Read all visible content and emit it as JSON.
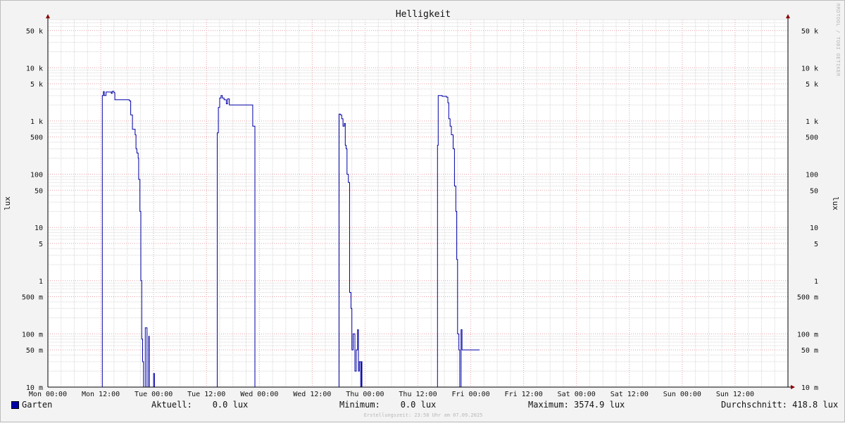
{
  "chart_data": {
    "type": "line",
    "title": "Helligkeit",
    "ylabel": "lux",
    "ylabel_right": "lux",
    "yscale": "log",
    "ylim": [
      0.01,
      80000
    ],
    "xlim": [
      "Mon 00:00",
      "Sun 24:00"
    ],
    "grid": true,
    "x_tick_labels": [
      "Mon 00:00",
      "Mon 12:00",
      "Tue 00:00",
      "Tue 12:00",
      "Wed 00:00",
      "Wed 12:00",
      "Thu 00:00",
      "Thu 12:00",
      "Fri 00:00",
      "Fri 12:00",
      "Sat 00:00",
      "Sat 12:00",
      "Sun 00:00",
      "Sun 12:00"
    ],
    "y_ticks": [
      {
        "value": 50000,
        "label": "50 k"
      },
      {
        "value": 10000,
        "label": "10 k"
      },
      {
        "value": 5000,
        "label": "5 k"
      },
      {
        "value": 1000,
        "label": "1 k"
      },
      {
        "value": 500,
        "label": "500"
      },
      {
        "value": 100,
        "label": "100"
      },
      {
        "value": 50,
        "label": "50"
      },
      {
        "value": 10,
        "label": "10"
      },
      {
        "value": 5,
        "label": "5"
      },
      {
        "value": 1,
        "label": "1"
      },
      {
        "value": 0.5,
        "label": "500 m"
      },
      {
        "value": 0.1,
        "label": "100 m"
      },
      {
        "value": 0.05,
        "label": "50 m"
      },
      {
        "value": 0.01,
        "label": "10 m"
      }
    ],
    "series": [
      {
        "name": "Garten",
        "color": "#0000a8",
        "x_unit": "hours since Mon 00:00",
        "points": [
          [
            0,
            0.01
          ],
          [
            12.3,
            0.01
          ],
          [
            12.35,
            3000
          ],
          [
            12.6,
            3574.9
          ],
          [
            12.8,
            3000
          ],
          [
            13.2,
            3500
          ],
          [
            14.0,
            3500
          ],
          [
            14.4,
            3300
          ],
          [
            14.6,
            3600
          ],
          [
            15.0,
            3400
          ],
          [
            15.2,
            2500
          ],
          [
            16.5,
            2500
          ],
          [
            18.0,
            2500
          ],
          [
            18.5,
            2400
          ],
          [
            18.8,
            1300
          ],
          [
            19.2,
            700
          ],
          [
            19.6,
            700
          ],
          [
            19.8,
            550
          ],
          [
            20.0,
            300
          ],
          [
            20.2,
            250
          ],
          [
            20.5,
            200
          ],
          [
            20.6,
            80
          ],
          [
            20.9,
            20
          ],
          [
            21.1,
            1
          ],
          [
            21.3,
            0.08
          ],
          [
            21.5,
            0.03
          ],
          [
            21.7,
            0.01
          ],
          [
            22.1,
            0.13
          ],
          [
            22.3,
            0.13
          ],
          [
            22.5,
            0.01
          ],
          [
            22.9,
            0.09
          ],
          [
            23.0,
            0.01
          ],
          [
            24.0,
            0.018
          ],
          [
            24.2,
            0.01
          ],
          [
            38.3,
            0.01
          ],
          [
            38.45,
            600
          ],
          [
            38.7,
            1800
          ],
          [
            39.0,
            2700
          ],
          [
            39.3,
            3000
          ],
          [
            39.6,
            2700
          ],
          [
            40.0,
            2500
          ],
          [
            40.5,
            2100
          ],
          [
            40.8,
            2600
          ],
          [
            41.2,
            2000
          ],
          [
            42.5,
            2000
          ],
          [
            45.0,
            2000
          ],
          [
            46.3,
            2000
          ],
          [
            46.5,
            800
          ],
          [
            47.0,
            0.01
          ],
          [
            66.0,
            0.01
          ],
          [
            66.1,
            1350
          ],
          [
            66.4,
            1300
          ],
          [
            66.7,
            1100
          ],
          [
            67.0,
            800
          ],
          [
            67.3,
            900
          ],
          [
            67.5,
            350
          ],
          [
            67.7,
            300
          ],
          [
            67.9,
            100
          ],
          [
            68.2,
            70
          ],
          [
            68.5,
            0.6
          ],
          [
            68.8,
            0.3
          ],
          [
            69.0,
            0.05
          ],
          [
            69.3,
            0.1
          ],
          [
            69.5,
            0.1
          ],
          [
            69.7,
            0.02
          ],
          [
            70.0,
            0.05
          ],
          [
            70.3,
            0.12
          ],
          [
            70.5,
            0.02
          ],
          [
            70.7,
            0.03
          ],
          [
            71.0,
            0.01
          ],
          [
            71.2,
            0.03
          ],
          [
            71.3,
            0.01
          ],
          [
            88.3,
            0.01
          ],
          [
            88.45,
            350
          ],
          [
            88.6,
            3000
          ],
          [
            89.5,
            2900
          ],
          [
            90.5,
            2800
          ],
          [
            90.8,
            2200
          ],
          [
            91.0,
            1100
          ],
          [
            91.3,
            800
          ],
          [
            91.6,
            550
          ],
          [
            92.0,
            300
          ],
          [
            92.3,
            60
          ],
          [
            92.6,
            20
          ],
          [
            92.8,
            2.5
          ],
          [
            93.0,
            0.1
          ],
          [
            93.3,
            0.05
          ],
          [
            93.5,
            0.01
          ],
          [
            93.8,
            0.12
          ],
          [
            94.0,
            0.05
          ],
          [
            98.0,
            0.05
          ]
        ]
      }
    ],
    "legend": {
      "series_label": "Garten",
      "current": "Aktuell:    0.0 lux",
      "minimum": "Minimum:    0.0 lux",
      "maximum": "Maximum: 3574.9 lux",
      "average": "Durchschnitt: 418.8 lux"
    }
  },
  "watermark": "RRDTOOL / TOBI OETIKER",
  "footer": "Erstellungszeit: 23:58 Uhr am 07.09.2025",
  "colors": {
    "background": "#f3f3f3",
    "canvas": "#ffffff",
    "major_grid": "#e8a0a8",
    "minor_grid": "#d6d6d6",
    "line": "#0000a8",
    "arrow": "#8b0000"
  }
}
